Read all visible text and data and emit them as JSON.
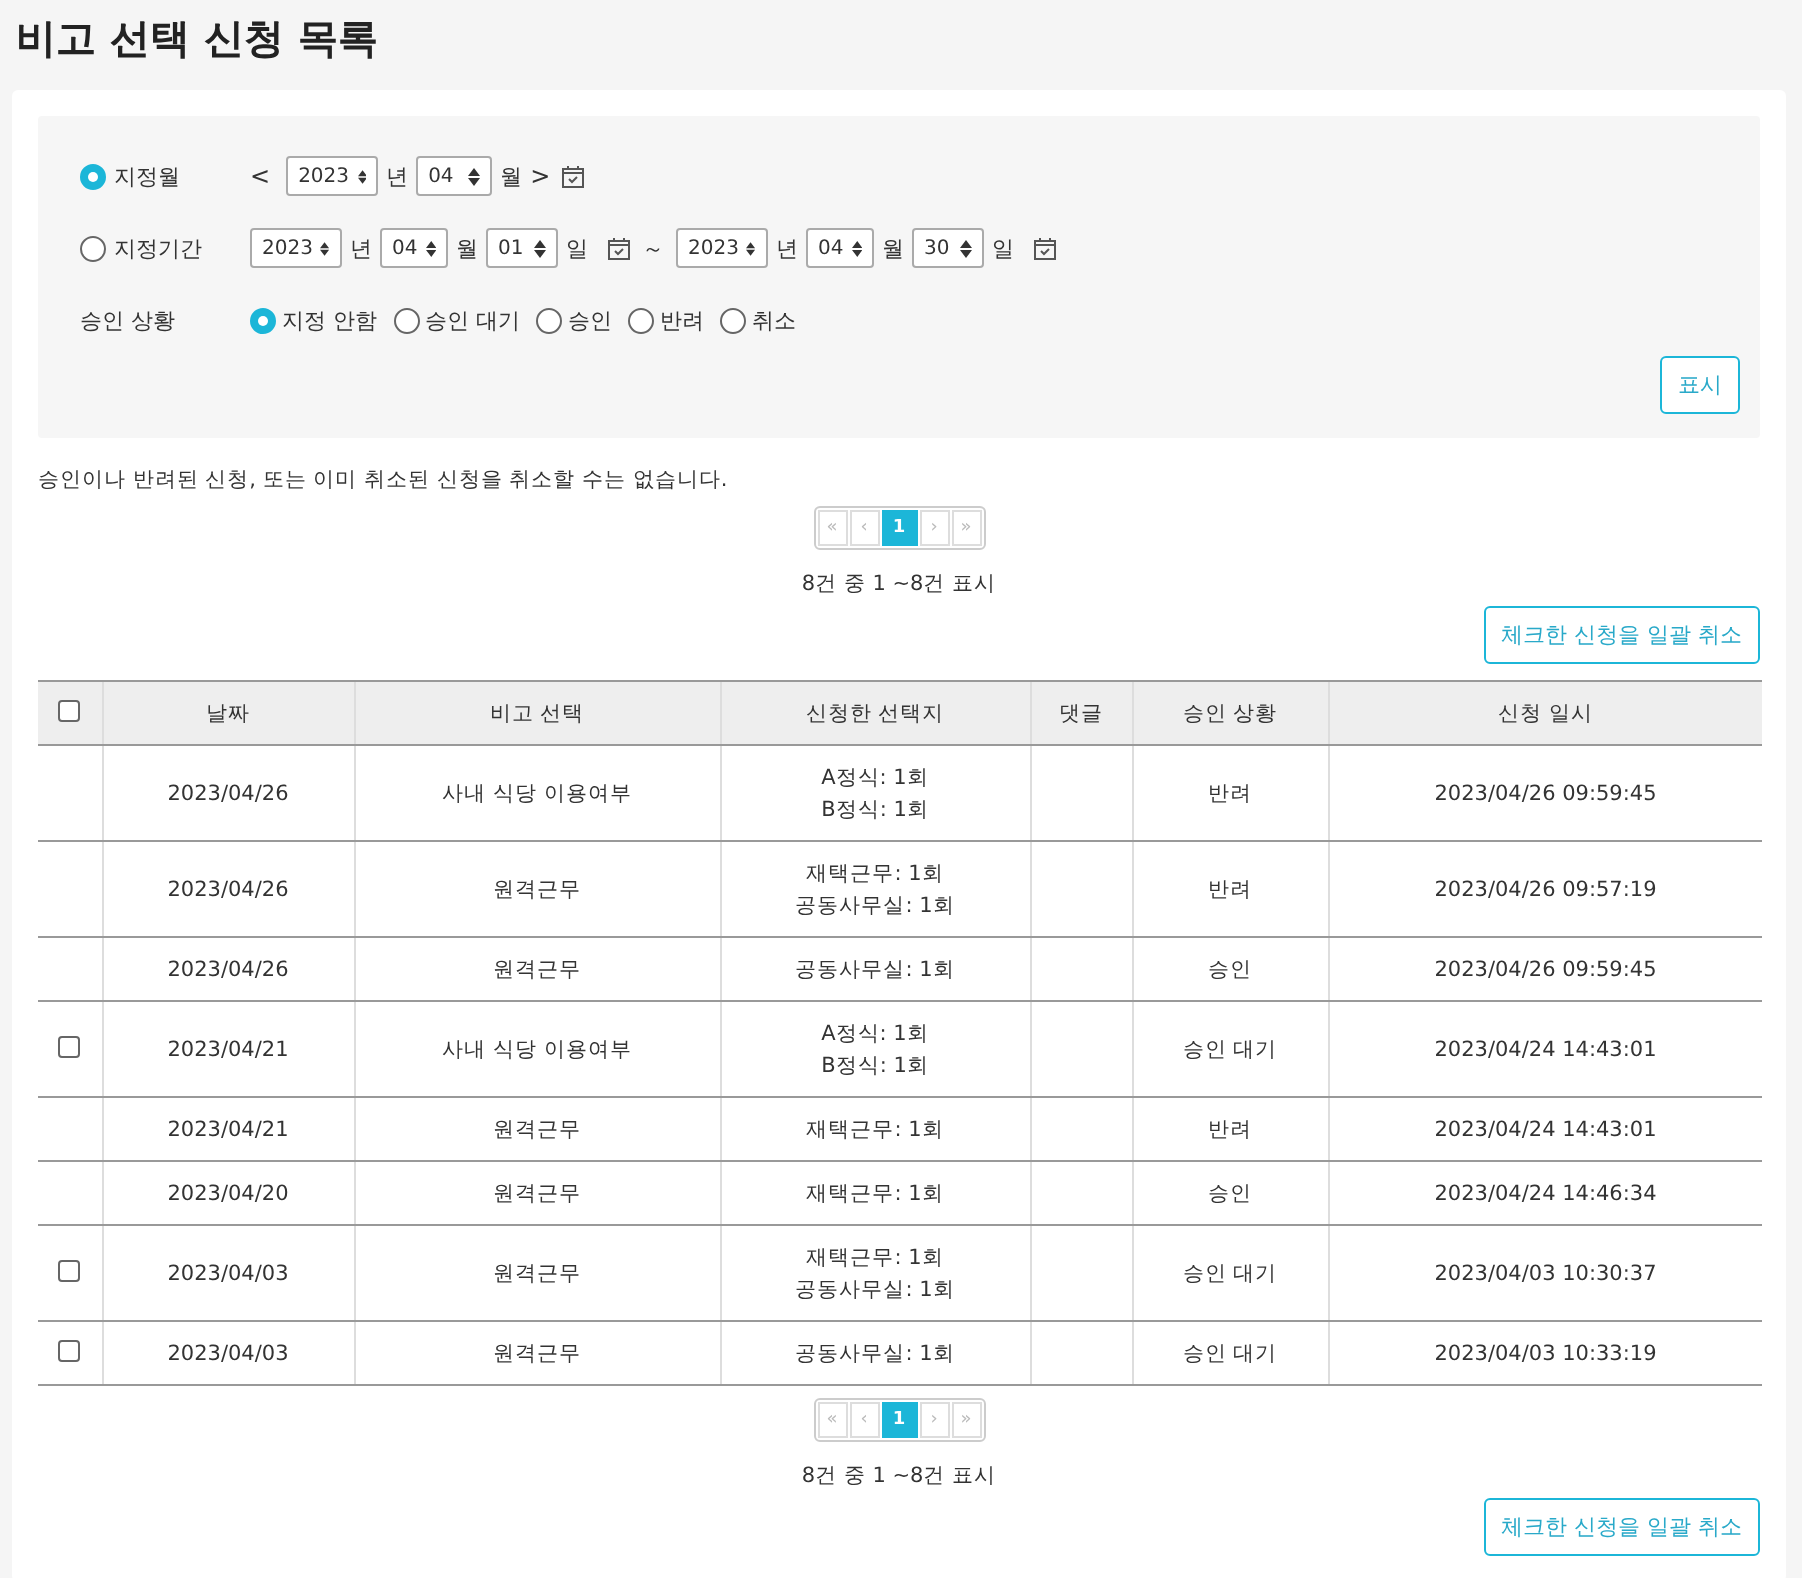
{
  "title": "비고 선택 신청 목록",
  "filter": {
    "month_mode": {
      "label": "지정월",
      "selected": true,
      "prev": "<",
      "year": "2023",
      "year_unit": "년",
      "month": "04",
      "month_unit": "월",
      "next": ">"
    },
    "range_mode": {
      "label": "지정기간",
      "selected": false,
      "from": {
        "year": "2023",
        "year_unit": "년",
        "month": "04",
        "month_unit": "월",
        "day": "01",
        "day_unit": "일"
      },
      "separator": "～",
      "to": {
        "year": "2023",
        "year_unit": "년",
        "month": "04",
        "month_unit": "월",
        "day": "30",
        "day_unit": "일"
      }
    },
    "status": {
      "label": "승인 상황",
      "options": [
        {
          "label": "지정 안함",
          "selected": true
        },
        {
          "label": "승인 대기",
          "selected": false
        },
        {
          "label": "승인",
          "selected": false
        },
        {
          "label": "반려",
          "selected": false
        },
        {
          "label": "취소",
          "selected": false
        }
      ]
    },
    "show_button": "표시"
  },
  "notice": "승인이나 반려된 신청, 또는 이미 취소된 신청을 취소할 수는 없습니다.",
  "pagination_top": {
    "first": "«",
    "prev": "‹",
    "pages": [
      {
        "label": "1",
        "selected": true
      }
    ],
    "next": "›",
    "last": "»",
    "summary": "8건 중 1 ~8건 표시"
  },
  "bulk_cancel_top": "체크한 신청을 일괄 취소",
  "table": {
    "header_checkbox": {
      "checked": false
    },
    "columns": [
      "날짜",
      "비고 선택",
      "신청한 선택지",
      "댓글",
      "승인 상황",
      "신청 일시"
    ],
    "rows": [
      {
        "date": "2023/04/26",
        "option": "사내 식당 이용여부",
        "choices": [
          "A정식: 1회",
          "B정식: 1회"
        ],
        "status": "반려",
        "requested_at": "2023/04/26 09:59:45"
      },
      {
        "date": "2023/04/26",
        "option": "원격근무",
        "choices": [
          "재택근무: 1회",
          "공동사무실: 1회"
        ],
        "status": "반려",
        "requested_at": "2023/04/26 09:57:19"
      },
      {
        "date": "2023/04/26",
        "option": "원격근무",
        "choices": [
          "공동사무실: 1회"
        ],
        "status": "승인",
        "requested_at": "2023/04/26 09:59:45"
      },
      {
        "checkbox": {
          "checked": false
        },
        "date": "2023/04/21",
        "option": "사내 식당 이용여부",
        "choices": [
          "A정식: 1회",
          "B정식: 1회"
        ],
        "status": "승인 대기",
        "requested_at": "2023/04/24 14:43:01"
      },
      {
        "date": "2023/04/21",
        "option": "원격근무",
        "choices": [
          "재택근무: 1회"
        ],
        "status": "반려",
        "requested_at": "2023/04/24 14:43:01"
      },
      {
        "date": "2023/04/20",
        "option": "원격근무",
        "choices": [
          "재택근무: 1회"
        ],
        "status": "승인",
        "requested_at": "2023/04/24 14:46:34"
      },
      {
        "checkbox": {
          "checked": false
        },
        "date": "2023/04/03",
        "option": "원격근무",
        "choices": [
          "재택근무: 1회",
          "공동사무실: 1회"
        ],
        "status": "승인 대기",
        "requested_at": "2023/04/03 10:30:37"
      },
      {
        "checkbox": {
          "checked": false
        },
        "date": "2023/04/03",
        "option": "원격근무",
        "choices": [
          "공동사무실: 1회"
        ],
        "status": "승인 대기",
        "requested_at": "2023/04/03 10:33:19"
      }
    ]
  },
  "pagination_bottom": {
    "first": "«",
    "prev": "‹",
    "pages": [
      {
        "label": "1",
        "selected": true
      }
    ],
    "next": "›",
    "last": "»",
    "summary": "8건 중 1 ~8건 표시"
  },
  "bulk_cancel_bottom": "체크한 신청을 일괄 취소"
}
